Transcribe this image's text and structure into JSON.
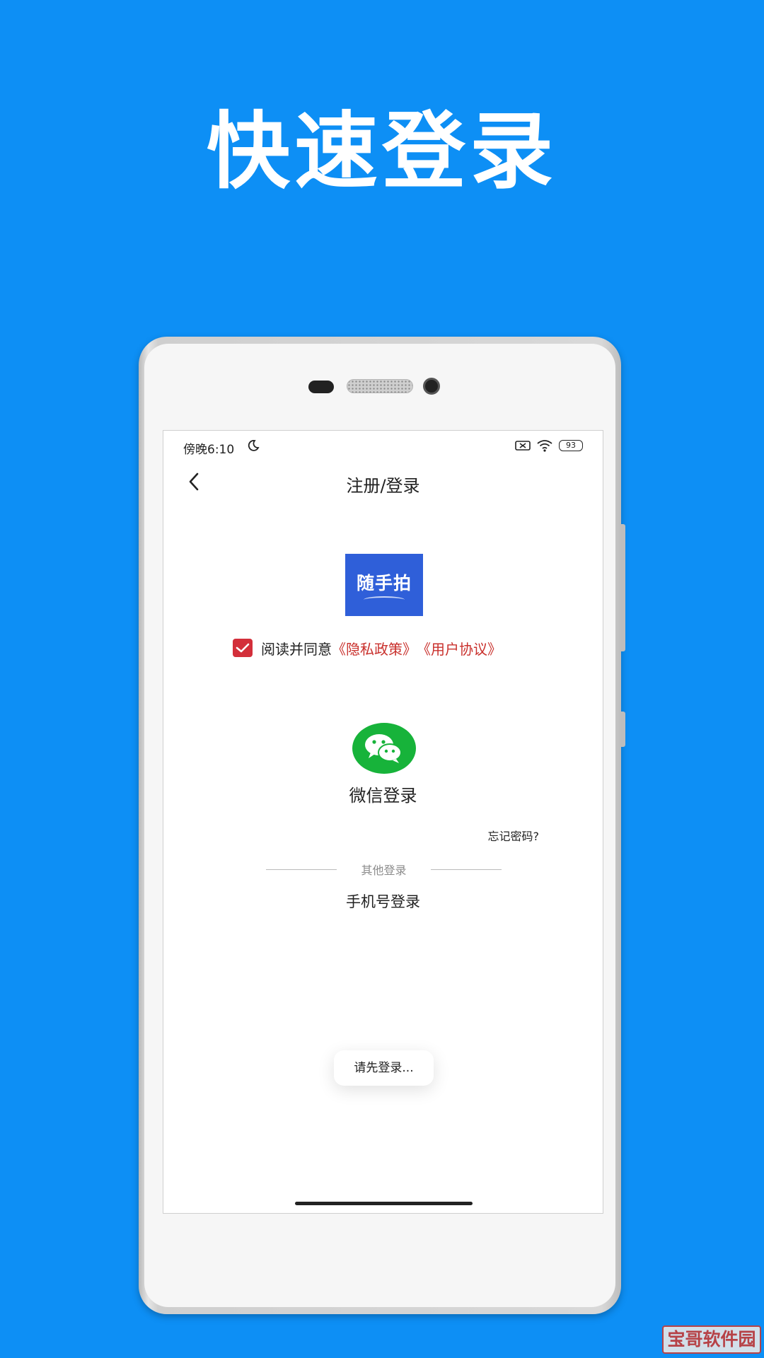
{
  "promo": {
    "title": "快速登录"
  },
  "status_bar": {
    "time": "傍晚6:10",
    "battery": "93"
  },
  "nav": {
    "title": "注册/登录"
  },
  "app_logo": {
    "text": "随手拍"
  },
  "agreement": {
    "checked": true,
    "prefix": "阅读并同意",
    "privacy_link": "《隐私政策》",
    "terms_link": "《用户协议》"
  },
  "wechat_login": {
    "label": "微信登录"
  },
  "forgot_password": "忘记密码?",
  "other_login": {
    "divider_text": "其他登录",
    "phone_login": "手机号登录"
  },
  "toast": "请先登录...",
  "watermark": "宝哥软件园",
  "colors": {
    "background": "#0d8ff5",
    "accent_red": "#d32f3a",
    "logo_blue": "#2f5fd9",
    "wechat_green": "#17b33a"
  },
  "icons": [
    "back-icon",
    "moon-icon",
    "no-sim-icon",
    "wifi-icon",
    "battery-icon",
    "checkbox-checked-icon",
    "wechat-icon"
  ]
}
